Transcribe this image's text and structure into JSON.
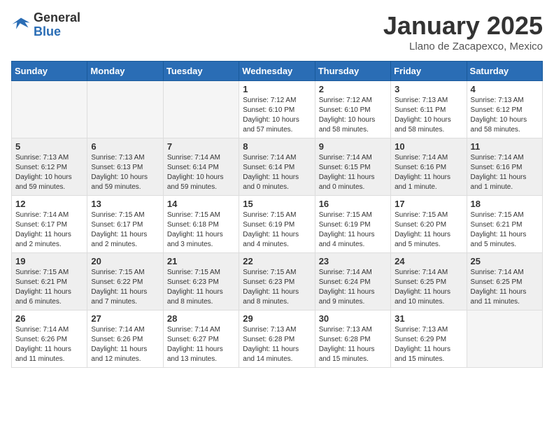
{
  "header": {
    "logo_general": "General",
    "logo_blue": "Blue",
    "month_title": "January 2025",
    "location": "Llano de Zacapexco, Mexico"
  },
  "weekdays": [
    "Sunday",
    "Monday",
    "Tuesday",
    "Wednesday",
    "Thursday",
    "Friday",
    "Saturday"
  ],
  "weeks": [
    [
      {
        "day": "",
        "info": ""
      },
      {
        "day": "",
        "info": ""
      },
      {
        "day": "",
        "info": ""
      },
      {
        "day": "1",
        "info": "Sunrise: 7:12 AM\nSunset: 6:10 PM\nDaylight: 10 hours and 57 minutes."
      },
      {
        "day": "2",
        "info": "Sunrise: 7:12 AM\nSunset: 6:10 PM\nDaylight: 10 hours and 58 minutes."
      },
      {
        "day": "3",
        "info": "Sunrise: 7:13 AM\nSunset: 6:11 PM\nDaylight: 10 hours and 58 minutes."
      },
      {
        "day": "4",
        "info": "Sunrise: 7:13 AM\nSunset: 6:12 PM\nDaylight: 10 hours and 58 minutes."
      }
    ],
    [
      {
        "day": "5",
        "info": "Sunrise: 7:13 AM\nSunset: 6:12 PM\nDaylight: 10 hours and 59 minutes."
      },
      {
        "day": "6",
        "info": "Sunrise: 7:13 AM\nSunset: 6:13 PM\nDaylight: 10 hours and 59 minutes."
      },
      {
        "day": "7",
        "info": "Sunrise: 7:14 AM\nSunset: 6:14 PM\nDaylight: 10 hours and 59 minutes."
      },
      {
        "day": "8",
        "info": "Sunrise: 7:14 AM\nSunset: 6:14 PM\nDaylight: 11 hours and 0 minutes."
      },
      {
        "day": "9",
        "info": "Sunrise: 7:14 AM\nSunset: 6:15 PM\nDaylight: 11 hours and 0 minutes."
      },
      {
        "day": "10",
        "info": "Sunrise: 7:14 AM\nSunset: 6:16 PM\nDaylight: 11 hours and 1 minute."
      },
      {
        "day": "11",
        "info": "Sunrise: 7:14 AM\nSunset: 6:16 PM\nDaylight: 11 hours and 1 minute."
      }
    ],
    [
      {
        "day": "12",
        "info": "Sunrise: 7:14 AM\nSunset: 6:17 PM\nDaylight: 11 hours and 2 minutes."
      },
      {
        "day": "13",
        "info": "Sunrise: 7:15 AM\nSunset: 6:17 PM\nDaylight: 11 hours and 2 minutes."
      },
      {
        "day": "14",
        "info": "Sunrise: 7:15 AM\nSunset: 6:18 PM\nDaylight: 11 hours and 3 minutes."
      },
      {
        "day": "15",
        "info": "Sunrise: 7:15 AM\nSunset: 6:19 PM\nDaylight: 11 hours and 4 minutes."
      },
      {
        "day": "16",
        "info": "Sunrise: 7:15 AM\nSunset: 6:19 PM\nDaylight: 11 hours and 4 minutes."
      },
      {
        "day": "17",
        "info": "Sunrise: 7:15 AM\nSunset: 6:20 PM\nDaylight: 11 hours and 5 minutes."
      },
      {
        "day": "18",
        "info": "Sunrise: 7:15 AM\nSunset: 6:21 PM\nDaylight: 11 hours and 5 minutes."
      }
    ],
    [
      {
        "day": "19",
        "info": "Sunrise: 7:15 AM\nSunset: 6:21 PM\nDaylight: 11 hours and 6 minutes."
      },
      {
        "day": "20",
        "info": "Sunrise: 7:15 AM\nSunset: 6:22 PM\nDaylight: 11 hours and 7 minutes."
      },
      {
        "day": "21",
        "info": "Sunrise: 7:15 AM\nSunset: 6:23 PM\nDaylight: 11 hours and 8 minutes."
      },
      {
        "day": "22",
        "info": "Sunrise: 7:15 AM\nSunset: 6:23 PM\nDaylight: 11 hours and 8 minutes."
      },
      {
        "day": "23",
        "info": "Sunrise: 7:14 AM\nSunset: 6:24 PM\nDaylight: 11 hours and 9 minutes."
      },
      {
        "day": "24",
        "info": "Sunrise: 7:14 AM\nSunset: 6:25 PM\nDaylight: 11 hours and 10 minutes."
      },
      {
        "day": "25",
        "info": "Sunrise: 7:14 AM\nSunset: 6:25 PM\nDaylight: 11 hours and 11 minutes."
      }
    ],
    [
      {
        "day": "26",
        "info": "Sunrise: 7:14 AM\nSunset: 6:26 PM\nDaylight: 11 hours and 11 minutes."
      },
      {
        "day": "27",
        "info": "Sunrise: 7:14 AM\nSunset: 6:26 PM\nDaylight: 11 hours and 12 minutes."
      },
      {
        "day": "28",
        "info": "Sunrise: 7:14 AM\nSunset: 6:27 PM\nDaylight: 11 hours and 13 minutes."
      },
      {
        "day": "29",
        "info": "Sunrise: 7:13 AM\nSunset: 6:28 PM\nDaylight: 11 hours and 14 minutes."
      },
      {
        "day": "30",
        "info": "Sunrise: 7:13 AM\nSunset: 6:28 PM\nDaylight: 11 hours and 15 minutes."
      },
      {
        "day": "31",
        "info": "Sunrise: 7:13 AM\nSunset: 6:29 PM\nDaylight: 11 hours and 15 minutes."
      },
      {
        "day": "",
        "info": ""
      }
    ]
  ]
}
